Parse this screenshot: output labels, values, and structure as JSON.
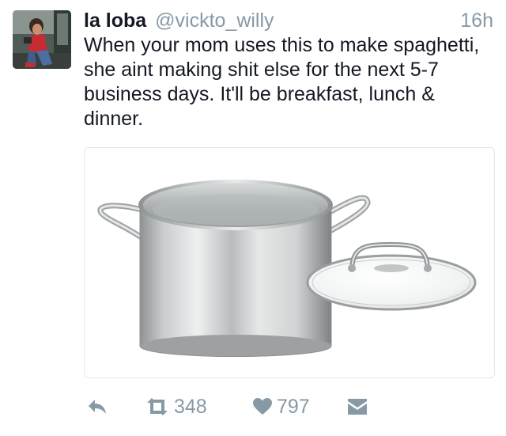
{
  "tweet": {
    "display_name": "la loba",
    "handle": "@vickto_willy",
    "timestamp": "16h",
    "text": "When your mom uses this to make spaghetti, she aint making shit else for the next 5-7 business days. It'll be breakfast, lunch & dinner."
  },
  "actions": {
    "reply_icon": "reply-icon",
    "retweet_icon": "retweet-icon",
    "retweet_count": "348",
    "like_icon": "heart-icon",
    "like_count": "797",
    "dm_icon": "direct-message-icon"
  },
  "colors": {
    "text": "#141823",
    "secondary": "#8899a6",
    "border": "#e1e8ed"
  }
}
